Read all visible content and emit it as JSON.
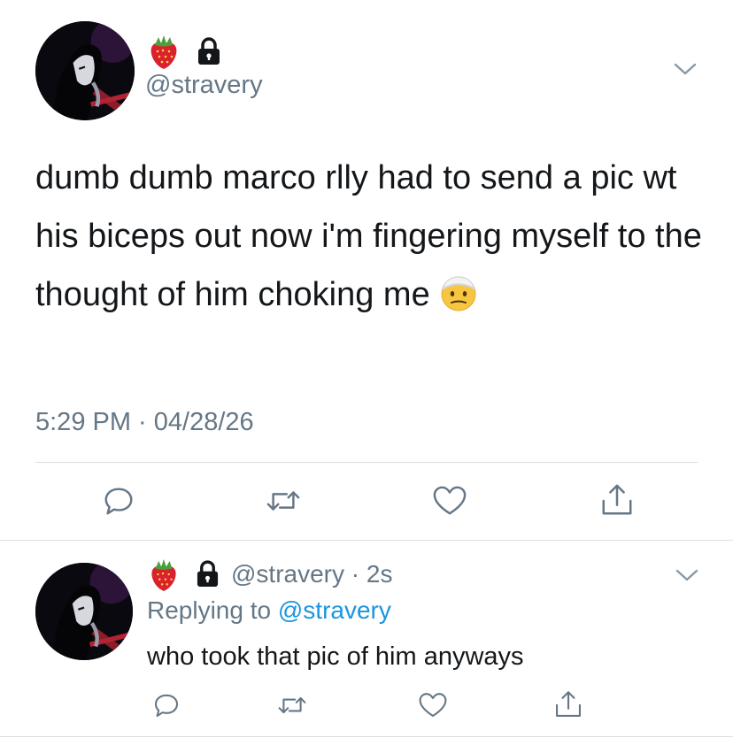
{
  "main_tweet": {
    "handle": "@stravery",
    "text": "dumb dumb marco rlly had to send a pic wt his biceps out now i'm fingering myself to the thought of him choking me",
    "emoji": "face-with-head-bandage",
    "time": "5:29 PM",
    "separator": " · ",
    "date": "04/28/26",
    "icons": [
      "strawberry-icon",
      "lock-icon",
      "chevron-down-icon"
    ]
  },
  "reply_tweet": {
    "handle": "@stravery",
    "separator": " · ",
    "age": "2s",
    "replying_prefix": "Replying to ",
    "replying_handle": "@stravery",
    "text": "who took that pic of him anyways",
    "icons": [
      "strawberry-icon",
      "lock-icon",
      "chevron-down-icon"
    ]
  },
  "actions": [
    "reply",
    "retweet",
    "like",
    "share"
  ],
  "colors": {
    "text": "#14171a",
    "secondary": "#657786",
    "link": "#1b95e0",
    "divider": "#d9dee3",
    "icon": "#657786"
  }
}
